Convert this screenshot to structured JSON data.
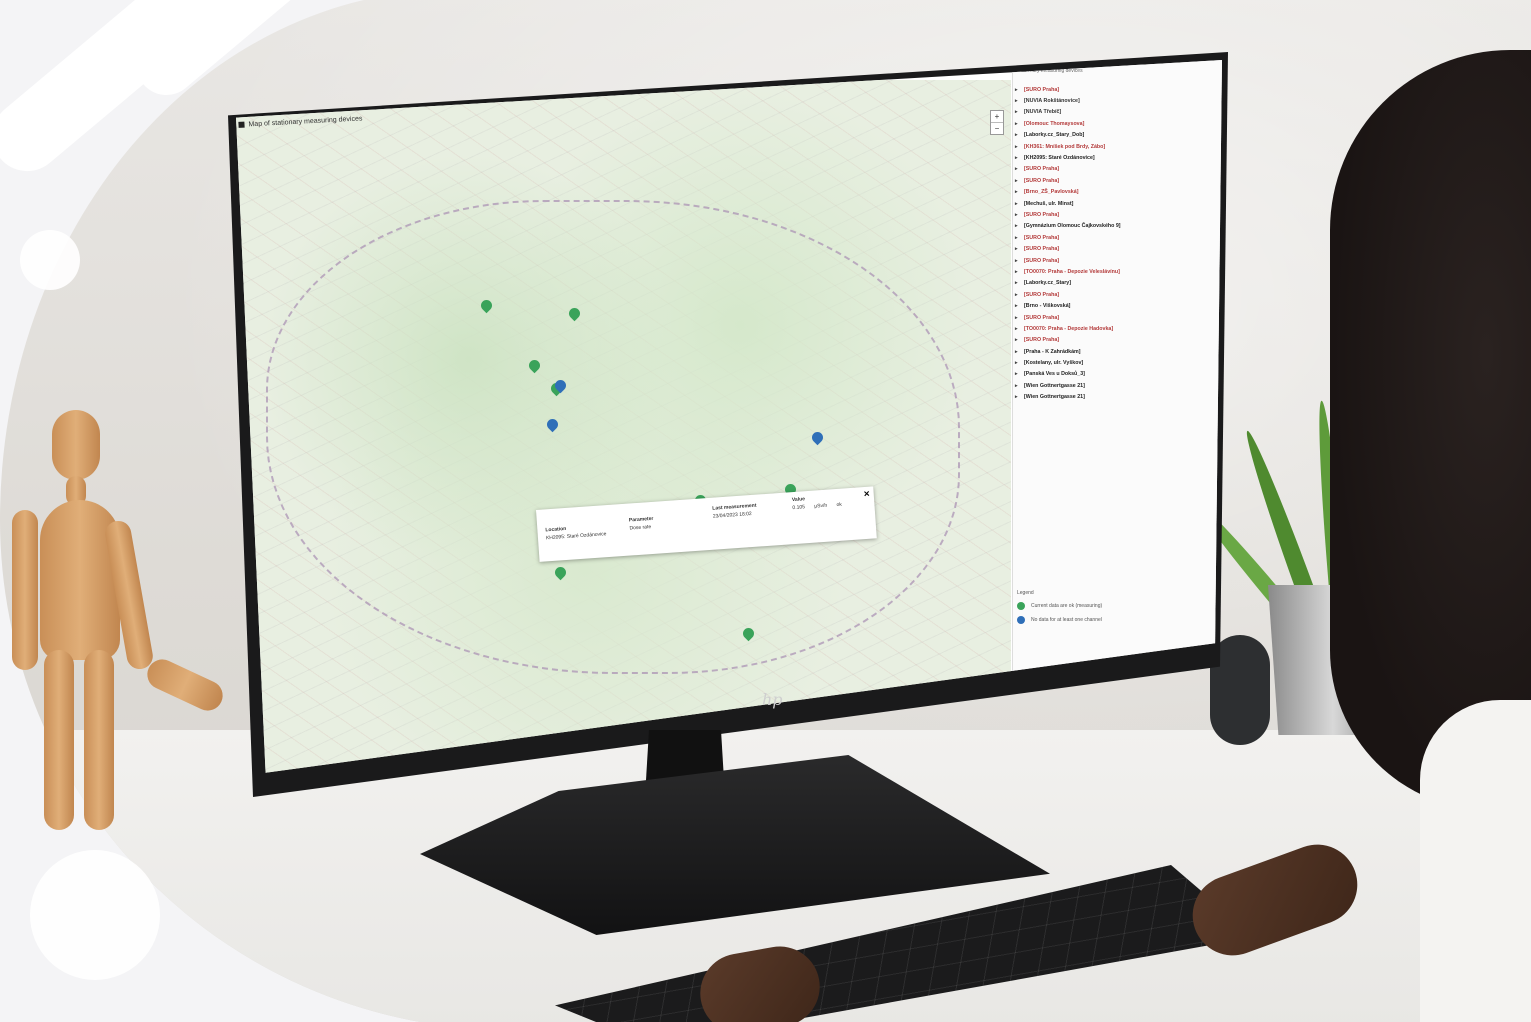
{
  "window": {
    "title": "Map of stationary measuring devices"
  },
  "map": {
    "zoom_in": "+",
    "zoom_out": "−"
  },
  "popup": {
    "location_label": "Location",
    "location_value": "KH2095: Staré Ozdánovice",
    "parameter_label": "Parameter",
    "parameter_value": "Dose rate",
    "last_label": "Last measurement",
    "last_value": "23/04/2023 18:02",
    "value_label": "Value",
    "value_number": "0.105",
    "value_unit": "μSv/h",
    "value_extra": "ok",
    "close": "×"
  },
  "panel": {
    "header": "Stationary measuring devices",
    "items": [
      "[SURO Praha]",
      "[NUVIA Rokštánovice]",
      "[NUVIA Třebíč]",
      "[Olomouc Thomaysova]",
      "[Laborky.cz_Stary_Dob]",
      "[KH361: Mníšek pod Brdy, Zábo]",
      "[KH2095: Staré Ozdánovice]",
      "[SURO Praha]",
      "[SURO Praha]",
      "[Brno_ZŠ_Pavlovská]",
      "[Mechuš, ulr. Minst]",
      "[SURO Praha]",
      "[Gymnázium Olomouc Čajkovského 9]",
      "[SURO Praha]",
      "[SURO Praha]",
      "[SURO Praha]",
      "[TO0070: Praha - Depozie Veleslávínu]",
      "[Laborky.cz_Stary]",
      "[SURO Praha]",
      "[Brno - Viškovská]",
      "[SURO Praha]",
      "[TO0070: Praha - Depozie Hadovka]",
      "[SURO Praha]",
      "[Praha - K Zahrádkám]",
      "[Kostelany, ulr. Vyškov]",
      "[Panská Ves u Doksů_3]",
      "[Wien Gottnertgasse 21]",
      "[Wien Gottnertgasse 21]"
    ],
    "item_colors": [
      "#b33a3a",
      "#333",
      "#333",
      "#b33a3a",
      "#222",
      "#b33a3a",
      "#222",
      "#b33a3a",
      "#b33a3a",
      "#b33a3a",
      "#222",
      "#b33a3a",
      "#222",
      "#b33a3a",
      "#b33a3a",
      "#b33a3a",
      "#b33a3a",
      "#222",
      "#b33a3a",
      "#222",
      "#b33a3a",
      "#b33a3a",
      "#b33a3a",
      "#222",
      "#222",
      "#222",
      "#222",
      "#222"
    ],
    "legend_header": "Legend",
    "legend": [
      {
        "label": "Current data are ok (measuring)",
        "color": "#3aa35a"
      },
      {
        "label": "No data for at least one channel",
        "color": "#2f6fb8"
      }
    ]
  },
  "markers": [
    {
      "color": "#3aa35a"
    },
    {
      "color": "#3aa35a"
    },
    {
      "color": "#3aa35a"
    },
    {
      "color": "#3aa35a"
    },
    {
      "color": "#2f6fb8"
    },
    {
      "color": "#2f6fb8"
    },
    {
      "color": "#2f6fb8"
    },
    {
      "color": "#3aa35a"
    },
    {
      "color": "#2f6fb8"
    },
    {
      "color": "#3aa35a"
    },
    {
      "color": "#3aa35a"
    },
    {
      "color": "#3aa35a"
    },
    {
      "color": "#3aa35a"
    }
  ],
  "brand": {
    "logo": "hp"
  }
}
